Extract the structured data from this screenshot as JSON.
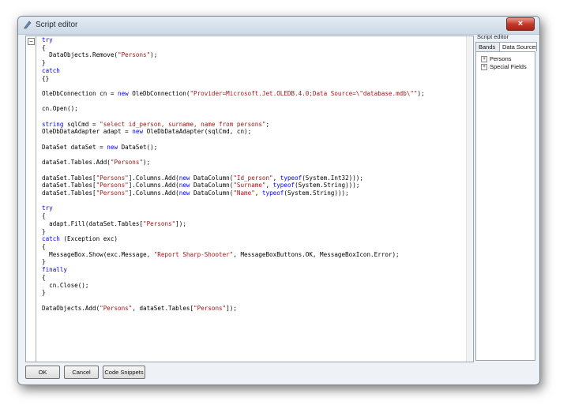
{
  "window": {
    "title": "Script editor"
  },
  "code_lines": [
    [
      {
        "t": "try",
        "c": "kw"
      }
    ],
    [
      {
        "t": "{"
      }
    ],
    [
      {
        "t": "  DataObjects.Remove("
      },
      {
        "t": "\"Persons\"",
        "c": "str"
      },
      {
        "t": ");"
      }
    ],
    [
      {
        "t": "}"
      }
    ],
    [
      {
        "t": "catch",
        "c": "kw"
      }
    ],
    [
      {
        "t": "{}"
      }
    ],
    [],
    [
      {
        "t": "OleDbConnection cn = "
      },
      {
        "t": "new",
        "c": "kw"
      },
      {
        "t": " OleDbConnection("
      },
      {
        "t": "\"Provider=Microsoft.Jet.OLEDB.4.0;Data Source=\\\"database.mdb\\\"\"",
        "c": "str"
      },
      {
        "t": ");"
      }
    ],
    [],
    [
      {
        "t": "cn.Open();"
      }
    ],
    [],
    [
      {
        "t": "string",
        "c": "kw"
      },
      {
        "t": " sqlCmd = "
      },
      {
        "t": "\"select id_person, surname, name from persons\"",
        "c": "str"
      },
      {
        "t": ";"
      }
    ],
    [
      {
        "t": "OleDbDataAdapter adapt = "
      },
      {
        "t": "new",
        "c": "kw"
      },
      {
        "t": " OleDbDataAdapter(sqlCmd, cn);"
      }
    ],
    [],
    [
      {
        "t": "DataSet dataSet = "
      },
      {
        "t": "new",
        "c": "kw"
      },
      {
        "t": " DataSet();"
      }
    ],
    [],
    [
      {
        "t": "dataSet.Tables.Add("
      },
      {
        "t": "\"Persons\"",
        "c": "str"
      },
      {
        "t": ");"
      }
    ],
    [],
    [
      {
        "t": "dataSet.Tables["
      },
      {
        "t": "\"Persons\"",
        "c": "str"
      },
      {
        "t": "].Columns.Add("
      },
      {
        "t": "new",
        "c": "kw"
      },
      {
        "t": " DataColumn("
      },
      {
        "t": "\"Id_person\"",
        "c": "str"
      },
      {
        "t": ", "
      },
      {
        "t": "typeof",
        "c": "kw"
      },
      {
        "t": "(System.Int32)));"
      }
    ],
    [
      {
        "t": "dataSet.Tables["
      },
      {
        "t": "\"Persons\"",
        "c": "str"
      },
      {
        "t": "].Columns.Add("
      },
      {
        "t": "new",
        "c": "kw"
      },
      {
        "t": " DataColumn("
      },
      {
        "t": "\"Surname\"",
        "c": "str"
      },
      {
        "t": ", "
      },
      {
        "t": "typeof",
        "c": "kw"
      },
      {
        "t": "(System.String)));"
      }
    ],
    [
      {
        "t": "dataSet.Tables["
      },
      {
        "t": "\"Persons\"",
        "c": "str"
      },
      {
        "t": "].Columns.Add("
      },
      {
        "t": "new",
        "c": "kw"
      },
      {
        "t": " DataColumn("
      },
      {
        "t": "\"Name\"",
        "c": "str"
      },
      {
        "t": ", "
      },
      {
        "t": "typeof",
        "c": "kw"
      },
      {
        "t": "(System.String)));"
      }
    ],
    [],
    [
      {
        "t": "try",
        "c": "kw"
      }
    ],
    [
      {
        "t": "{"
      }
    ],
    [
      {
        "t": "  adapt.Fill(dataSet.Tables["
      },
      {
        "t": "\"Persons\"",
        "c": "str"
      },
      {
        "t": "]);"
      }
    ],
    [
      {
        "t": "}"
      }
    ],
    [
      {
        "t": "catch",
        "c": "kw"
      },
      {
        "t": " (Exception exc)"
      }
    ],
    [
      {
        "t": "{"
      }
    ],
    [
      {
        "t": "  MessageBox.Show(exc.Message, "
      },
      {
        "t": "\"Report Sharp-Shooter\"",
        "c": "str"
      },
      {
        "t": ", MessageBoxButtons.OK, MessageBoxIcon.Error);"
      }
    ],
    [
      {
        "t": "}"
      }
    ],
    [
      {
        "t": "finally",
        "c": "kw"
      }
    ],
    [
      {
        "t": "{"
      }
    ],
    [
      {
        "t": "  cn.Close();"
      }
    ],
    [
      {
        "t": "}"
      }
    ],
    [],
    [
      {
        "t": "DataObjects.Add("
      },
      {
        "t": "\"Persons\"",
        "c": "str"
      },
      {
        "t": ", dataSet.Tables["
      },
      {
        "t": "\"Persons\"",
        "c": "str"
      },
      {
        "t": "]);"
      }
    ]
  ],
  "right_panel": {
    "title": "Script editor",
    "tabs": [
      {
        "label": "Bands",
        "active": false
      },
      {
        "label": "Data Sources",
        "active": true
      }
    ],
    "tree": [
      {
        "label": "Persons",
        "expander": "+"
      },
      {
        "label": "Special Fields",
        "expander": "+"
      }
    ]
  },
  "buttons": {
    "ok": "OK",
    "cancel": "Cancel",
    "snippets": "Code Snippets"
  },
  "icons": {
    "close": "close-icon",
    "app": "script-icon",
    "fold": "fold-minus-icon"
  },
  "colors": {
    "keyword": "#0000ff",
    "string": "#a31515",
    "close": "#c5392a"
  }
}
